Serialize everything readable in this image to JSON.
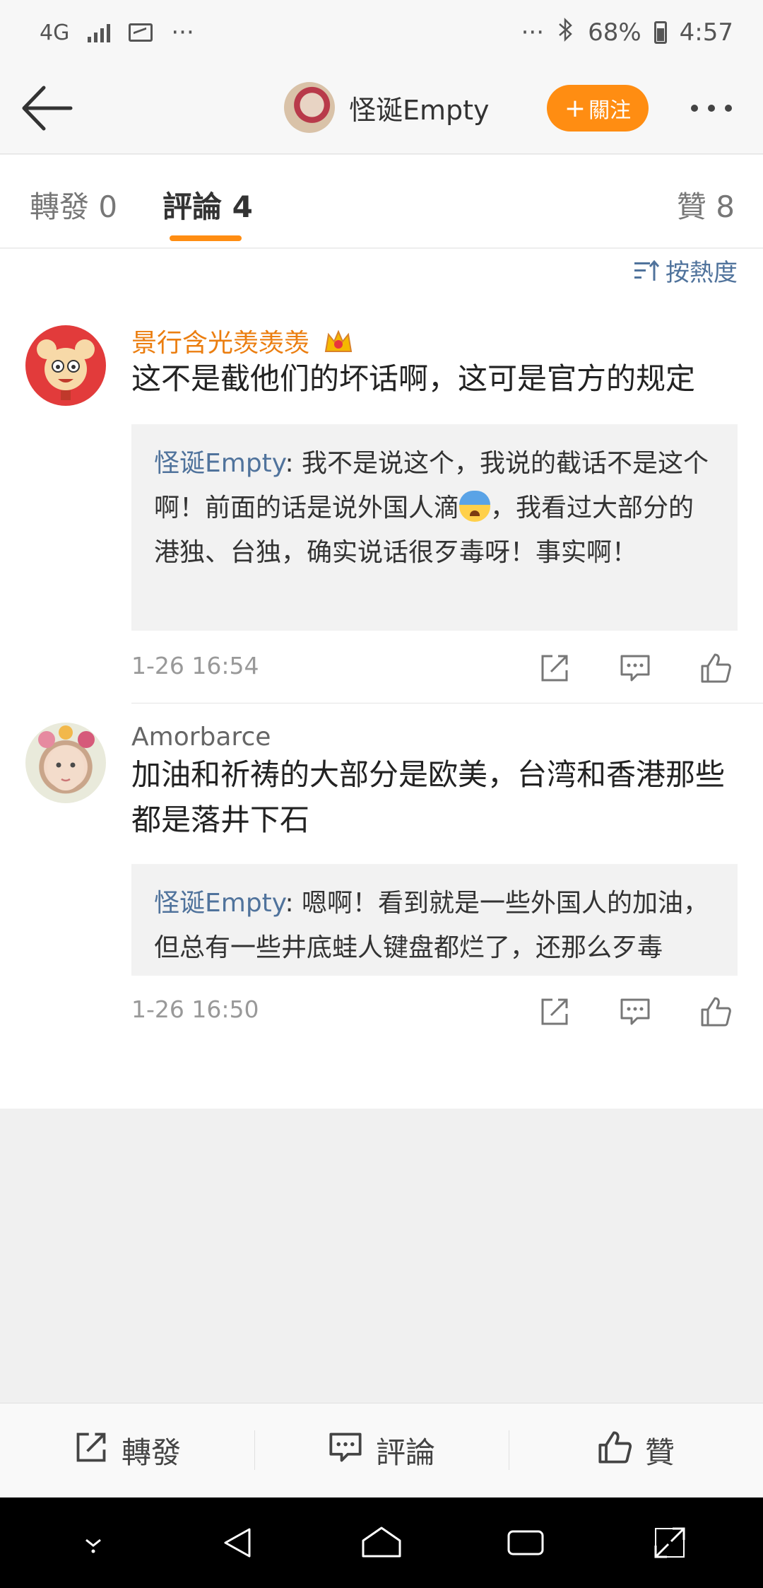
{
  "status_bar": {
    "network": "4G",
    "dots_left": "···",
    "dots_right": "···",
    "battery": "68%",
    "time": "4:57"
  },
  "header": {
    "username": "怪诞Empty",
    "follow_label": "關注",
    "follow_plus": "+"
  },
  "tabs": [
    {
      "label": "轉發 0"
    },
    {
      "label": "評論 4"
    },
    {
      "label": "贊 8"
    }
  ],
  "sort": {
    "label": "按熱度"
  },
  "comments": [
    {
      "username": "景行含光羡羡羡",
      "text": "这不是截他们的坏话啊，这可是官方的规定",
      "reply_name": "怪诞Empty",
      "reply_text_a": ": 我不是说这个，我说的截话不是这个啊！前面的话是说外国人滴",
      "reply_text_b": "，我看过大部分的港独、台独，确实说话很歹毒呀！事实啊！",
      "time": "1-26 16:54"
    },
    {
      "username": "Amorbarce",
      "text": "加油和祈祷的大部分是欧美，台湾和香港那些都是落井下石",
      "reply_name": "怪诞Empty",
      "reply_text": ": 嗯啊！看到就是一些外国人的加油，但总有一些井底蛙人键盘都烂了，还那么歹毒",
      "time": "1-26 16:50"
    }
  ],
  "bottom_bar": {
    "repost_label": "轉發",
    "comment_label": "評論",
    "like_label": "贊"
  },
  "colors": {
    "accent_orange": "#ff8d12",
    "link_blue": "#50739c",
    "vip_name": "#eb7e10"
  }
}
